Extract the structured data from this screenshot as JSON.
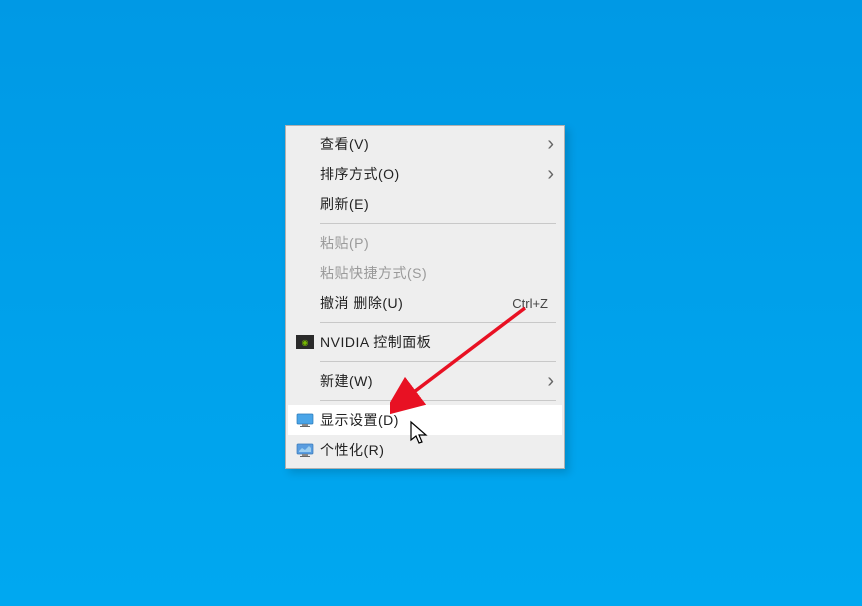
{
  "context_menu": {
    "items": [
      {
        "label": "查看(V)",
        "has_submenu": true,
        "disabled": false,
        "icon": null
      },
      {
        "label": "排序方式(O)",
        "has_submenu": true,
        "disabled": false,
        "icon": null
      },
      {
        "label": "刷新(E)",
        "has_submenu": false,
        "disabled": false,
        "icon": null
      }
    ],
    "items2": [
      {
        "label": "粘贴(P)",
        "has_submenu": false,
        "disabled": true,
        "icon": null
      },
      {
        "label": "粘贴快捷方式(S)",
        "has_submenu": false,
        "disabled": true,
        "icon": null
      },
      {
        "label": "撤消 删除(U)",
        "has_submenu": false,
        "disabled": false,
        "icon": null,
        "shortcut": "Ctrl+Z"
      }
    ],
    "items3": [
      {
        "label": "NVIDIA 控制面板",
        "has_submenu": false,
        "disabled": false,
        "icon": "nvidia"
      }
    ],
    "items4": [
      {
        "label": "新建(W)",
        "has_submenu": true,
        "disabled": false,
        "icon": null
      }
    ],
    "items5": [
      {
        "label": "显示设置(D)",
        "has_submenu": false,
        "disabled": false,
        "icon": "display",
        "hover": true
      },
      {
        "label": "个性化(R)",
        "has_submenu": false,
        "disabled": false,
        "icon": "personalize"
      }
    ]
  }
}
